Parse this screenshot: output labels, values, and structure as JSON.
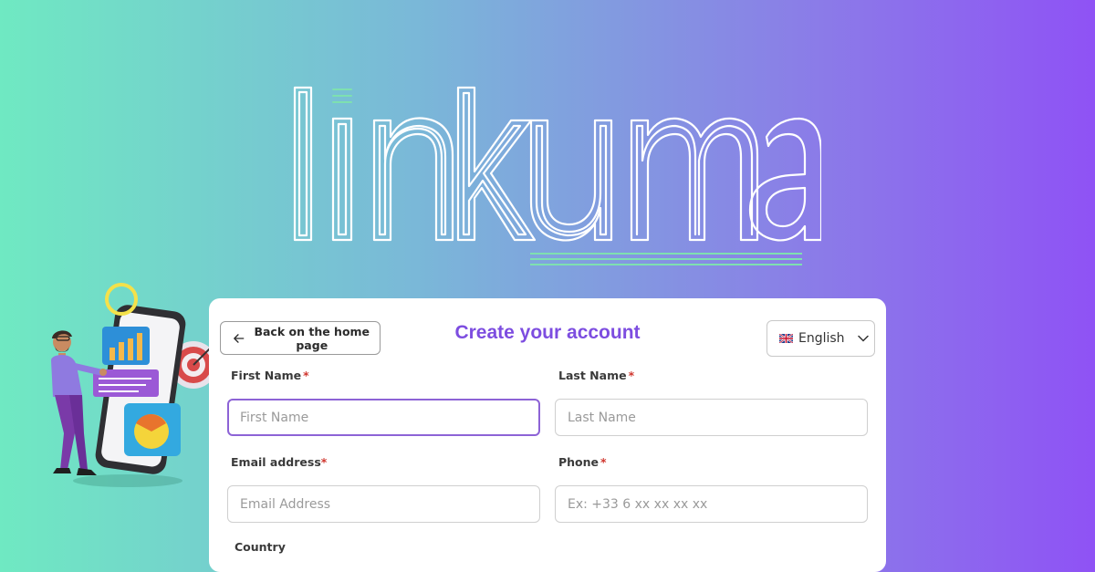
{
  "brand": {
    "logo_text": "Linkuma"
  },
  "form": {
    "back_label": "Back on the home page",
    "title": "Create your account",
    "language": "English",
    "first_name": {
      "label": "First Name",
      "required": "*",
      "placeholder": "First Name",
      "value": ""
    },
    "last_name": {
      "label": "Last Name",
      "required": "*",
      "placeholder": "Last Name",
      "value": ""
    },
    "email": {
      "label": "Email address",
      "required": "*",
      "placeholder": "Email Address",
      "value": ""
    },
    "phone": {
      "label": "Phone",
      "required": "*",
      "placeholder": "Ex: +33 6 xx xx xx xx",
      "value": ""
    },
    "country": {
      "label": "Country"
    }
  },
  "colors": {
    "accent": "#7d4de0",
    "focus_border": "#8d63d6",
    "required": "#d0372f",
    "gradient_start": "#6fe9c2",
    "gradient_end": "#8f52f5",
    "logo_underline": "#7ee0b0"
  },
  "icons": {
    "back": "arrow-left-icon",
    "language_flag": "uk-flag-icon",
    "language_toggle": "chevron-down-icon"
  }
}
